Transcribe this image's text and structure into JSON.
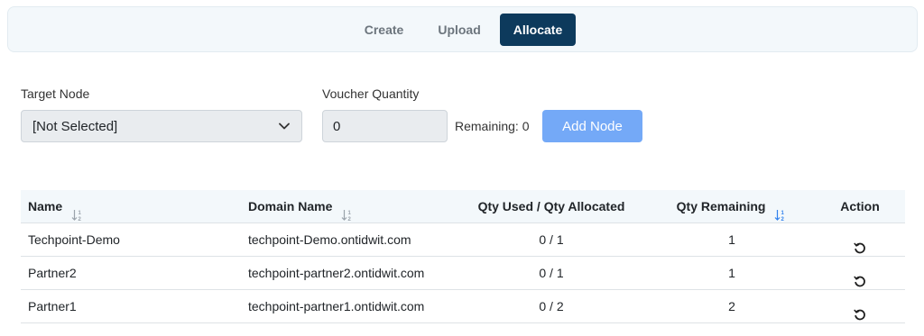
{
  "tabs": [
    {
      "label": "Create",
      "active": false
    },
    {
      "label": "Upload",
      "active": false
    },
    {
      "label": "Allocate",
      "active": true
    }
  ],
  "form": {
    "target_node_label": "Target Node",
    "target_node_value": "[Not Selected]",
    "voucher_quantity_label": "Voucher Quantity",
    "voucher_quantity_value": "0",
    "remaining_text": "Remaining: 0",
    "add_node_label": "Add Node"
  },
  "table": {
    "headers": {
      "name": "Name",
      "domain": "Domain Name",
      "qty": "Qty Used / Qty Allocated",
      "remaining": "Qty Remaining",
      "action": "Action"
    },
    "rows": [
      {
        "name": "Techpoint-Demo",
        "domain": "techpoint-Demo.ontidwit.com",
        "qty": "0 / 1",
        "remaining": "1"
      },
      {
        "name": "Partner2",
        "domain": "techpoint-partner2.ontidwit.com",
        "qty": "0 / 1",
        "remaining": "1"
      },
      {
        "name": "Partner1",
        "domain": "techpoint-partner1.ontidwit.com",
        "qty": "0 / 2",
        "remaining": "2"
      }
    ]
  },
  "icons": {
    "sort": "sort-icon",
    "reload": "reload-icon",
    "chevron": "chevron-down-icon"
  },
  "colors": {
    "accent_dark": "#0d3a5c",
    "button_primary": "#74a9f7",
    "sort_active": "#2f80ed"
  }
}
